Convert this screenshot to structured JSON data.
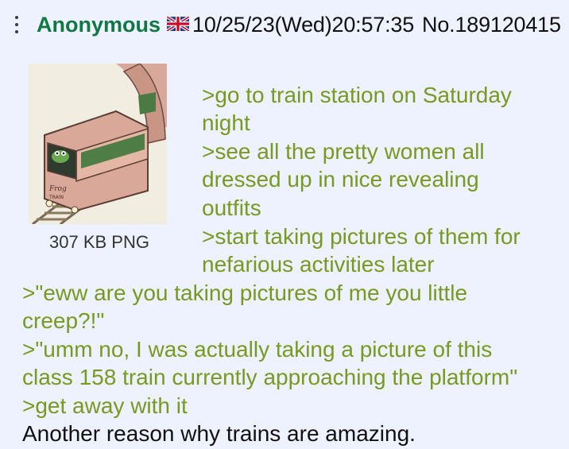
{
  "post": {
    "name": "Anonymous",
    "flag_icon": "uk-flag-icon",
    "datetime": "10/25/23(Wed)20:57:35",
    "post_no": "No.189120415",
    "file_info": "307 KB PNG",
    "thumbnail_text": "Frog TRAIN",
    "lines": [
      ">go to train station on Saturday",
      "night",
      ">see all the pretty women all",
      "dressed up in nice revealing",
      "outfits",
      ">start taking pictures of them for",
      "nefarious activities later",
      ">\"eww are you taking pictures of me you little",
      "creep?!\"",
      ">\"umm no, I was actually taking a picture of this",
      "class 158 train currently approaching the platform\"",
      ">get away with it",
      "Another reason why trains are amazing."
    ]
  },
  "colors": {
    "background": "#eef2ff",
    "name": "#117743",
    "greentext": "#789922",
    "text": "#111111"
  }
}
